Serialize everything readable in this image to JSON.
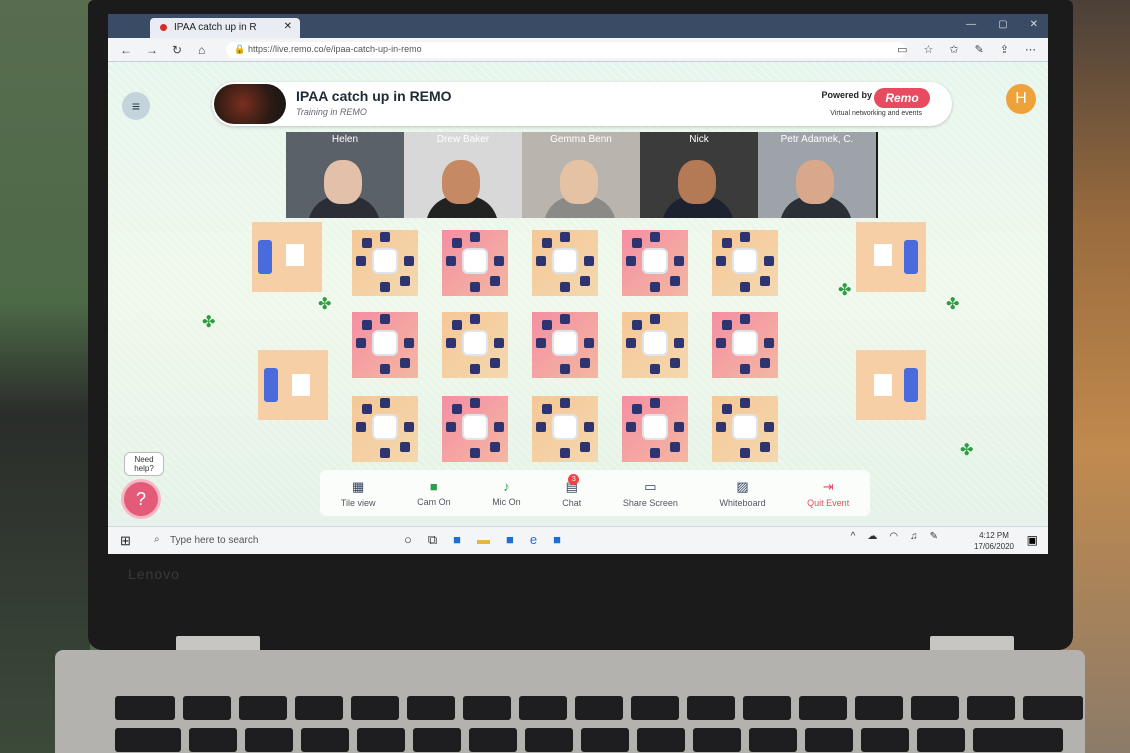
{
  "browser": {
    "tab_title": "IPAA catch up in R",
    "url": "https://live.remo.co/e/ipaa-catch-up-in-remo"
  },
  "event": {
    "title": "IPAA catch up in REMO",
    "subtitle": "Training in REMO",
    "powered_by": "Powered by",
    "brand": "Remo",
    "tagline": "Virtual networking and events",
    "user_initial": "H"
  },
  "participants": [
    {
      "name": "Helen"
    },
    {
      "name": "Drew Baker"
    },
    {
      "name": "Gemma Benn"
    },
    {
      "name": "Nick"
    },
    {
      "name": "Petr Adamek, C."
    }
  ],
  "help": {
    "prompt": "Need help?",
    "icon": "?"
  },
  "toolbar": [
    {
      "label": "Tile view",
      "icon": "grid-icon"
    },
    {
      "label": "Cam On",
      "icon": "camera-icon"
    },
    {
      "label": "Mic On",
      "icon": "mic-icon"
    },
    {
      "label": "Chat",
      "icon": "chat-icon",
      "badge": "3"
    },
    {
      "label": "Share Screen",
      "icon": "share-screen-icon"
    },
    {
      "label": "Whiteboard",
      "icon": "whiteboard-icon"
    },
    {
      "label": "Quit Event",
      "icon": "exit-icon"
    }
  ],
  "taskbar": {
    "search_placeholder": "Type here to search",
    "time": "4:12 PM",
    "date": "17/06/2020"
  },
  "laptop": {
    "brand": "Lenovo"
  },
  "colors": {
    "remo_red": "#e84a5f",
    "avatar_orange": "#f0a23a",
    "chair_navy": "#2e3470"
  }
}
